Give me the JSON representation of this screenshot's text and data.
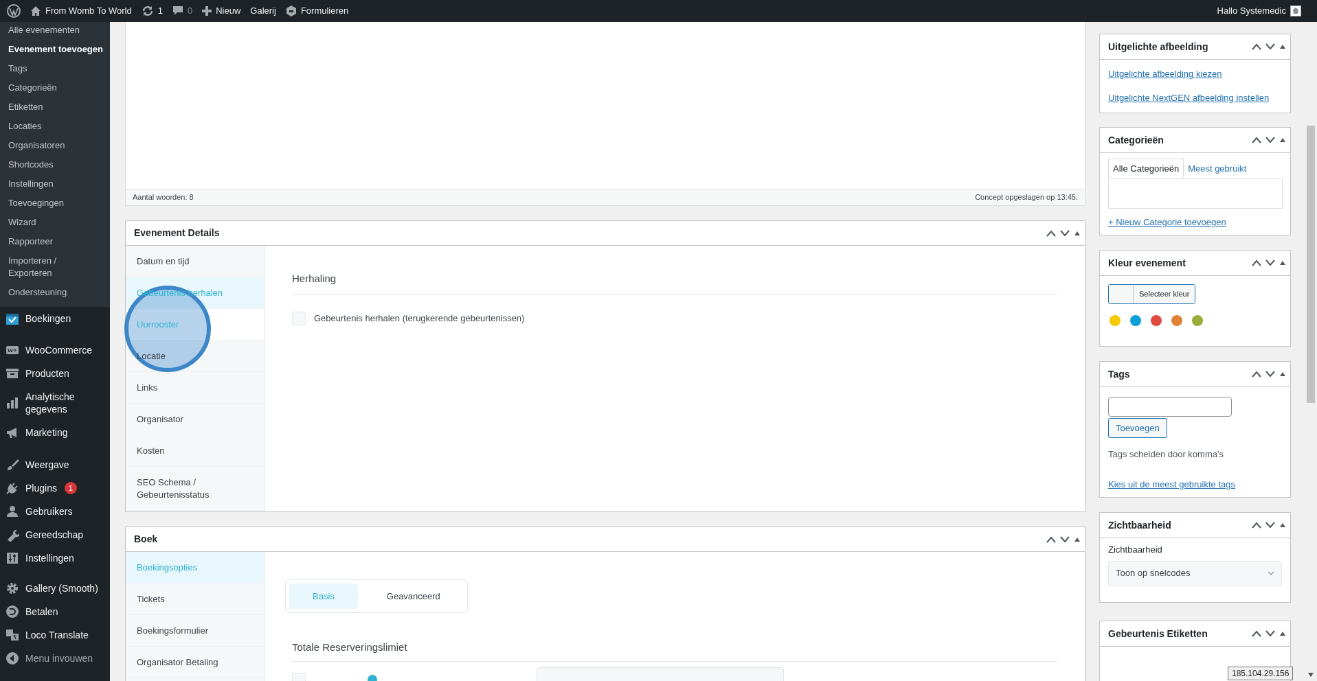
{
  "admin_bar": {
    "site": "From Womb To World",
    "updates": "1",
    "comments": "0",
    "new": "Nieuw",
    "links": [
      "Galerij",
      "Formulieren"
    ],
    "greeting": "Hallo Systemedic"
  },
  "sidebar": {
    "submenu": [
      {
        "label": "Alle evenementen",
        "selected": false
      },
      {
        "label": "Evenement toevoegen",
        "selected": true
      },
      {
        "label": "Tags",
        "selected": false
      },
      {
        "label": "Categorieën",
        "selected": false
      },
      {
        "label": "Etiketten",
        "selected": false
      },
      {
        "label": "Locaties",
        "selected": false
      },
      {
        "label": "Organisatoren",
        "selected": false
      },
      {
        "label": "Shortcodes",
        "selected": false
      },
      {
        "label": "Instellingen",
        "selected": false
      },
      {
        "label": "Toevoegingen",
        "selected": false
      },
      {
        "label": "Wizard",
        "selected": false
      },
      {
        "label": "Rapporteer",
        "selected": false
      },
      {
        "label": "Importeren / Exporteren",
        "selected": false
      },
      {
        "label": "Ondersteuning",
        "selected": false
      }
    ],
    "menu": [
      {
        "label": "Boekingen"
      },
      {
        "label": "WooCommerce"
      },
      {
        "label": "Producten"
      },
      {
        "label": "Analytische gegevens"
      },
      {
        "label": "Marketing"
      },
      {
        "label": "Weergave"
      },
      {
        "label": "Plugins",
        "badge": "1"
      },
      {
        "label": "Gebruikers"
      },
      {
        "label": "Gereedschap"
      },
      {
        "label": "Instellingen"
      },
      {
        "label": "Gallery (Smooth)"
      },
      {
        "label": "Betalen"
      },
      {
        "label": "Loco Translate"
      },
      {
        "label": "Menu invouwen"
      }
    ]
  },
  "editor": {
    "word_count": "Aantal woorden: 8",
    "saved": "Concept opgeslagen op 13:45."
  },
  "event_details": {
    "title": "Evenement Details",
    "tabs": [
      {
        "label": "Datum en tijd",
        "selected": false,
        "hovered": false
      },
      {
        "label": "Gebeurtenis herhalen",
        "selected": true,
        "hovered": false
      },
      {
        "label": "Uurrooster",
        "selected": false,
        "hovered": true
      },
      {
        "label": "Locatie",
        "selected": false,
        "hovered": false
      },
      {
        "label": "Links",
        "selected": false,
        "hovered": false
      },
      {
        "label": "Organisator",
        "selected": false,
        "hovered": false
      },
      {
        "label": "Kosten",
        "selected": false,
        "hovered": false
      },
      {
        "label": "SEO Schema / Gebeurtenisstatus",
        "selected": false,
        "hovered": false
      }
    ],
    "heading": "Herhaling",
    "repeat": {
      "label": "Gebeurtenis herhalen (terugkerende gebeurtenissen)",
      "checked": false
    }
  },
  "booking": {
    "title": "Boek",
    "tabs": [
      {
        "label": "Boekingsopties",
        "selected": true
      },
      {
        "label": "Tickets",
        "selected": false
      },
      {
        "label": "Boekingsformulier",
        "selected": false
      },
      {
        "label": "Organisator Betaling",
        "selected": false
      }
    ],
    "segments": [
      {
        "label": "Basis",
        "selected": true
      },
      {
        "label": "Geavanceerd",
        "selected": false
      }
    ],
    "heading": "Totale Reserveringslimiet",
    "limit": {
      "checked": false
    }
  },
  "right": {
    "featured": {
      "title": "Uitgelichte afbeelding",
      "links": [
        "Uitgelichte afbeelding kiezen",
        "Uitgelichte NextGEN afbeelding instellen"
      ]
    },
    "categories": {
      "title": "Categorieën",
      "tabs": [
        {
          "label": "Alle Categorieën",
          "selected": true
        },
        {
          "label": "Meest gebruikt",
          "selected": false
        }
      ],
      "add": "+ Nieuw Categorie toevoegen"
    },
    "color": {
      "title": "Kleur evenement",
      "button": "Selecteer kleur",
      "swatches": [
        {
          "color": "#f5c800"
        },
        {
          "color": "#0d9fd8"
        },
        {
          "color": "#e04b3f"
        },
        {
          "color": "#e18336"
        },
        {
          "color": "#9aad3a"
        }
      ]
    },
    "tags": {
      "title": "Tags",
      "button": "Toevoegen",
      "hint": "Tags scheiden door komma's",
      "link": "Kies uit de meest gebruikte tags"
    },
    "visibility": {
      "title": "Zichtbaarheid",
      "label": "Zichtbaarheid",
      "value": "Toon op snelcodes"
    },
    "labels": {
      "title": "Gebeurtenis Etiketten"
    }
  },
  "tooltip": "185.104.29.156"
}
